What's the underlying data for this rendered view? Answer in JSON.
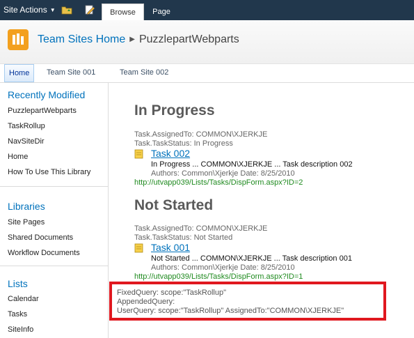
{
  "ribbon": {
    "site_actions": "Site Actions",
    "tabs": [
      {
        "label": "Browse"
      },
      {
        "label": "Page"
      }
    ]
  },
  "breadcrumb": {
    "parent": "Team Sites Home",
    "current": "PuzzlepartWebparts"
  },
  "topnav": [
    {
      "label": "Home",
      "active": true
    },
    {
      "label": "Team Site 001"
    },
    {
      "label": "Team Site 002"
    }
  ],
  "sidebar": {
    "recently_modified": {
      "header": "Recently Modified",
      "items": [
        "PuzzlepartWebparts",
        "TaskRollup",
        "NavSiteDir",
        "Home",
        "How To Use This Library"
      ]
    },
    "libraries": {
      "header": "Libraries",
      "items": [
        "Site Pages",
        "Shared Documents",
        "Workflow Documents"
      ]
    },
    "lists": {
      "header": "Lists",
      "items": [
        "Calendar",
        "Tasks",
        "SiteInfo"
      ]
    }
  },
  "groups": [
    {
      "title": "In Progress",
      "assigned": "Task.AssignedTo: COMMON\\XJERKJE",
      "status": "Task.TaskStatus: In Progress",
      "task": {
        "title": "Task 002",
        "desc": "In Progress ... COMMON\\XJERKJE ... Task description 002",
        "authors": "Authors: Common\\Xjerkje   Date: 8/25/2010",
        "url": "http://utvapp039/Lists/Tasks/DispForm.aspx?ID=2"
      }
    },
    {
      "title": "Not Started",
      "assigned": "Task.AssignedTo: COMMON\\XJERKJE",
      "status": "Task.TaskStatus: Not Started",
      "task": {
        "title": "Task 001",
        "desc": "Not Started ... COMMON\\XJERKJE ... Task description 001",
        "authors": "Authors: Common\\Xjerkje   Date: 8/25/2010",
        "url": "http://utvapp039/Lists/Tasks/DispForm.aspx?ID=1"
      }
    }
  ],
  "queries": {
    "fixed": "FixedQuery: scope:\"TaskRollup\"",
    "appended": "AppendedQuery:",
    "user": "UserQuery: scope:\"TaskRollup\" AssignedTo:\"COMMON\\XJERKJE\""
  },
  "colors": {
    "ribbon_bg": "#21374c",
    "link": "#0072bc",
    "url_green": "#1f8a1f",
    "highlight_border": "#e0181f",
    "logo_orange": "#f3a01e"
  }
}
